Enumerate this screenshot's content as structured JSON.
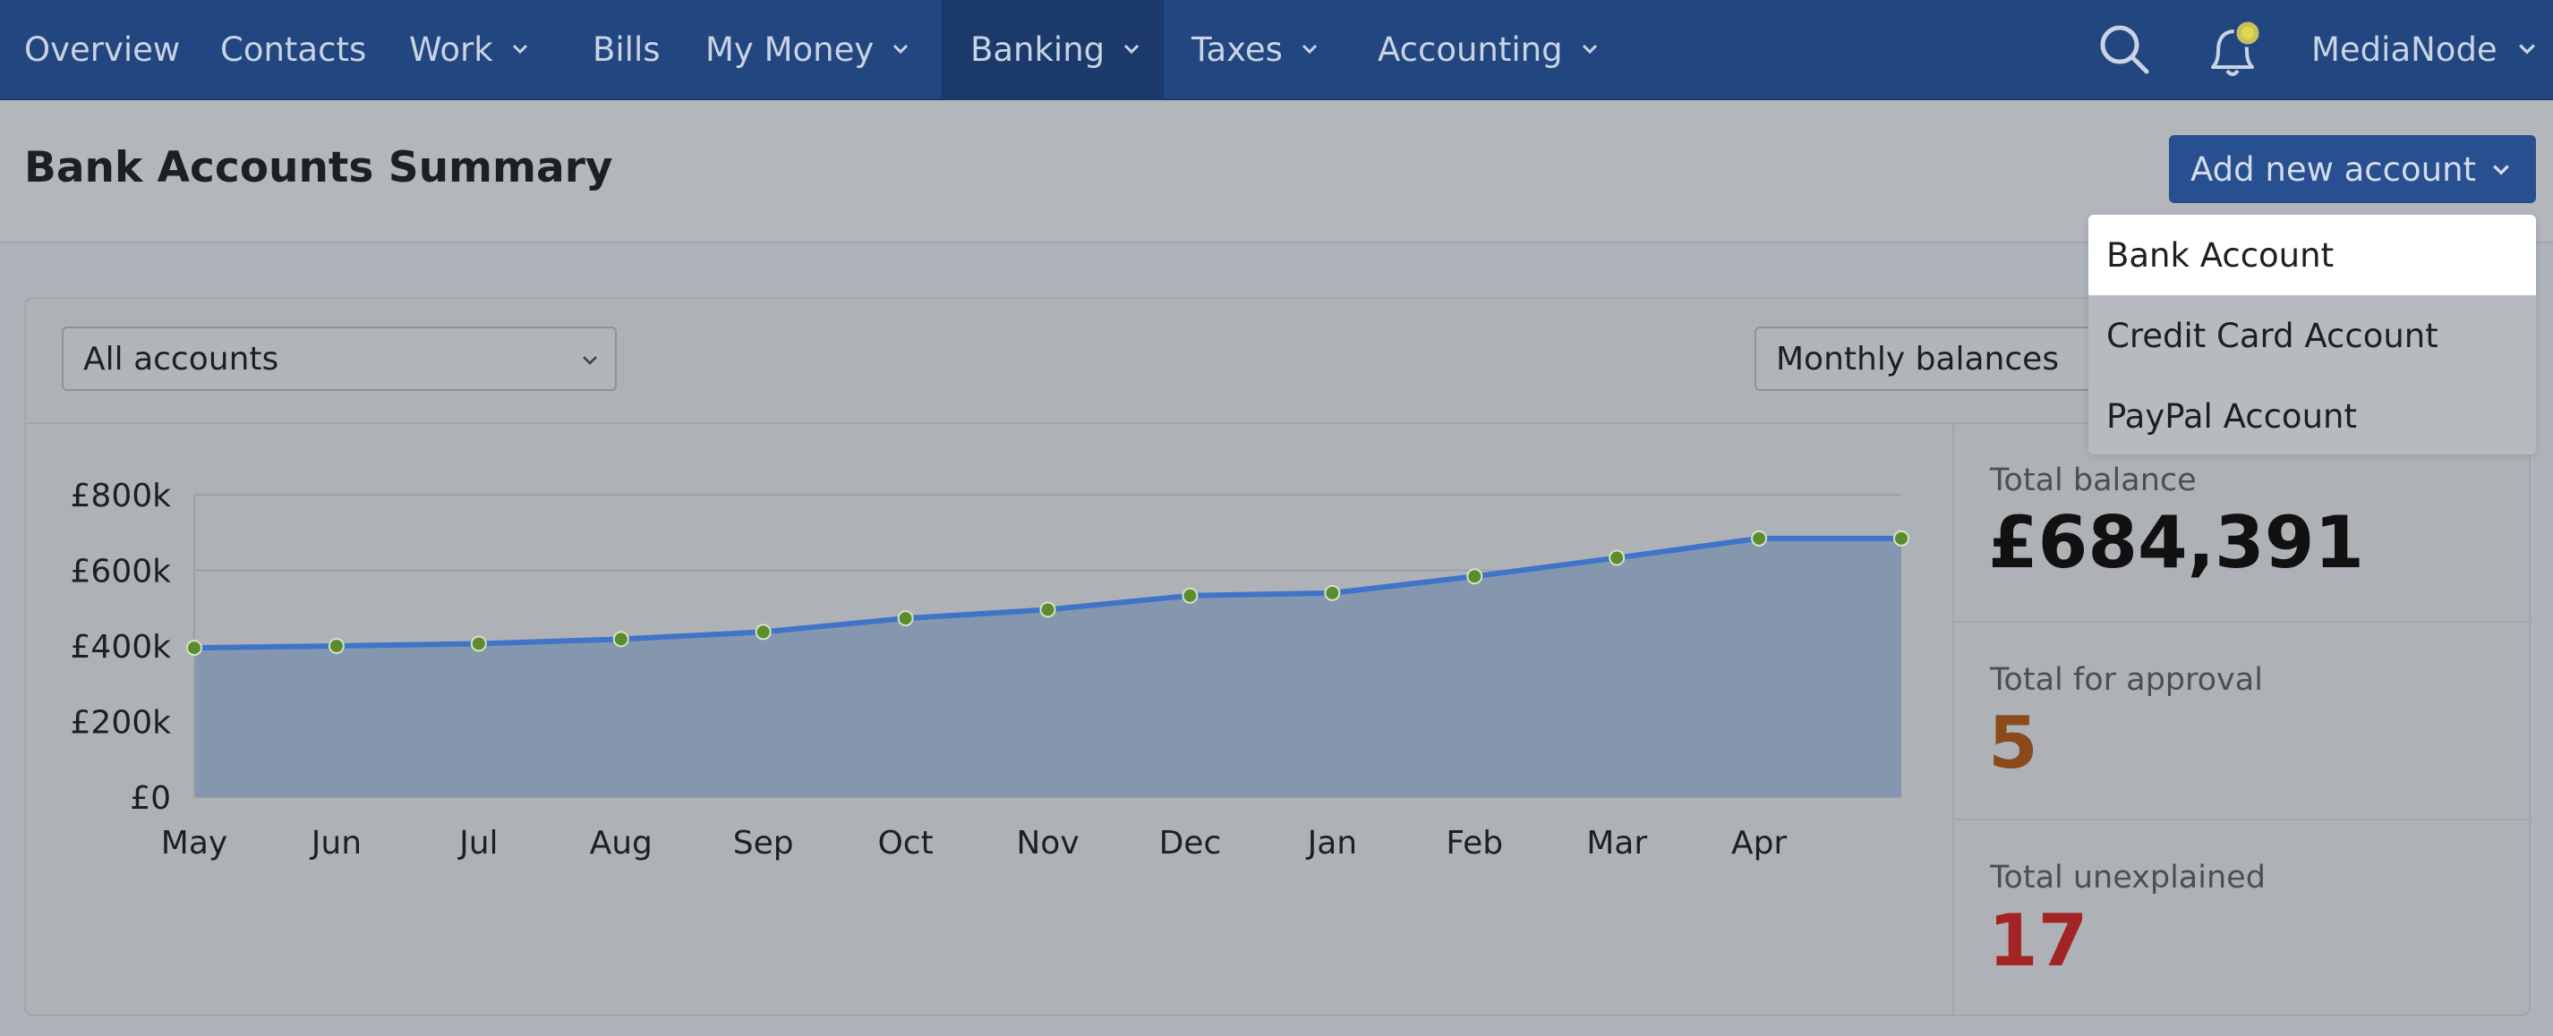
{
  "nav": {
    "items": [
      {
        "label": "Overview",
        "dropdown": false,
        "active": false
      },
      {
        "label": "Contacts",
        "dropdown": false,
        "active": false
      },
      {
        "label": "Work",
        "dropdown": true,
        "active": false
      },
      {
        "label": "Bills",
        "dropdown": false,
        "active": false
      },
      {
        "label": "My Money",
        "dropdown": true,
        "active": false
      },
      {
        "label": "Banking",
        "dropdown": true,
        "active": true
      },
      {
        "label": "Taxes",
        "dropdown": true,
        "active": false
      },
      {
        "label": "Accounting",
        "dropdown": true,
        "active": false
      }
    ],
    "search_icon": "search-icon",
    "notification_icon": "bell-icon",
    "org_name": "MediaNode"
  },
  "header": {
    "title": "Bank Accounts Summary",
    "add_button_label": "Add new account"
  },
  "dropdown_menu": {
    "items": [
      "Bank Account",
      "Credit Card Account",
      "PayPal Account"
    ],
    "highlighted_index": 0
  },
  "filters": {
    "account_select": "All accounts",
    "view_select": "Monthly balances"
  },
  "stats": {
    "total_balance_label": "Total balance",
    "total_balance_value": "£684,391",
    "approval_label": "Total for approval",
    "approval_value": "5",
    "unexplained_label": "Total unexplained",
    "unexplained_value": "17"
  },
  "colors": {
    "nav_bg": "#22467f",
    "line": "#3f74c9",
    "area_fill": "#8497af",
    "marker": "#5c8c2e",
    "approval_value": "#8a4a1c",
    "unexplained_value": "#a32424"
  },
  "chart_data": {
    "type": "area",
    "categories": [
      "May",
      "Jun",
      "Jul",
      "Aug",
      "Sep",
      "Oct",
      "Nov",
      "Dec",
      "Jan",
      "Feb",
      "Mar",
      "Apr"
    ],
    "x_end_label": "",
    "values": [
      395000,
      400000,
      406000,
      418000,
      437000,
      473000,
      496000,
      533000,
      540000,
      584000,
      633000,
      684391,
      684391
    ],
    "ylim": [
      0,
      800000
    ],
    "yticks": [
      "£0",
      "£200k",
      "£400k",
      "£600k",
      "£800k"
    ],
    "ytick_values": [
      0,
      200000,
      400000,
      600000,
      800000
    ],
    "grid": true,
    "xlabel": "",
    "ylabel": ""
  }
}
